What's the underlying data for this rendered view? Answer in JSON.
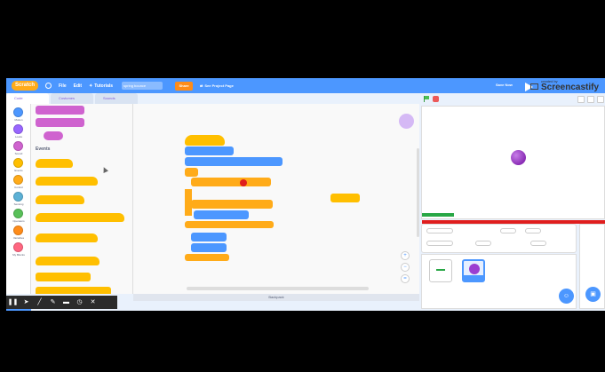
{
  "menubar": {
    "logo": "Scratch",
    "file": "File",
    "edit": "Edit",
    "tutorials": "Tutorials",
    "project_title": "spring bounce",
    "share": "Share",
    "project_page": "See Project Page",
    "save_now": "Save Now"
  },
  "watermark": {
    "small": "created by",
    "big": "Screencastify"
  },
  "tabs": [
    "Code",
    "Costumes",
    "Sounds"
  ],
  "categories": [
    {
      "label": "Motion",
      "color": "#4c97ff"
    },
    {
      "label": "Looks",
      "color": "#9966ff"
    },
    {
      "label": "Sound",
      "color": "#cf63cf"
    },
    {
      "label": "Events",
      "color": "#ffbf00"
    },
    {
      "label": "Control",
      "color": "#ffab19"
    },
    {
      "label": "Sensing",
      "color": "#5cb1d6"
    },
    {
      "label": "Operators",
      "color": "#59c059"
    },
    {
      "label": "Variables",
      "color": "#ff8c1a"
    },
    {
      "label": "My Blocks",
      "color": "#ff6680"
    }
  ],
  "palette": {
    "events_heading": "Events"
  },
  "workspace": {
    "backpack": "Backpack"
  },
  "colors": {
    "menubar": "#4c97ff",
    "events": "#ffbf00",
    "control": "#ffab19",
    "motion": "#4c97ff",
    "sensing": "#5cb1d6",
    "sound": "#cf63cf"
  },
  "icons": [
    "globe-icon",
    "tutorials-icon",
    "project-page-icon",
    "green-flag-icon",
    "stop-icon",
    "add-extension-icon",
    "choose-sprite-icon",
    "choose-backdrop-icon",
    "zoom-in-icon",
    "zoom-out-icon",
    "zoom-reset-icon"
  ],
  "annotation_tools": [
    "pause-icon",
    "cursor-icon",
    "pen-icon",
    "highlighter-icon",
    "eraser-icon",
    "timer-icon",
    "close-icon"
  ]
}
